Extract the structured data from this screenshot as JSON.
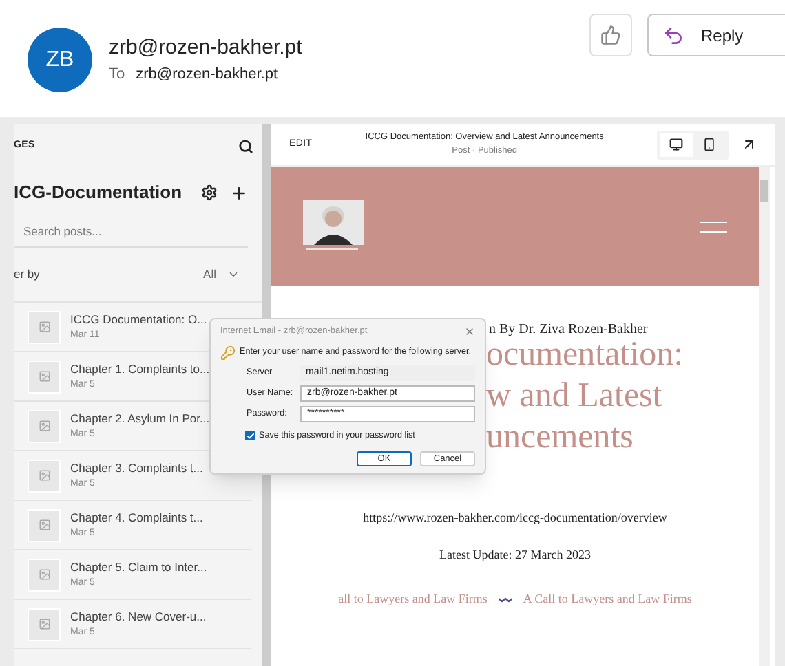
{
  "email": {
    "avatar_initials": "ZB",
    "sender": "zrb@rozen-bakher.pt",
    "to_label": "To",
    "to_address": "zrb@rozen-bakher.pt",
    "reply": "Reply"
  },
  "sidebar": {
    "section_label": "GES",
    "title": "ICG-Documentation",
    "search": {
      "placeholder": "Search posts..."
    },
    "filter_label": "er by",
    "filter_value": "All",
    "posts": [
      {
        "title": "ICCG Documentation: O...",
        "date": "Mar 11"
      },
      {
        "title": "Chapter 1. Complaints to...",
        "date": "Mar 5"
      },
      {
        "title": "Chapter 2. Asylum In Por...",
        "date": "Mar 5"
      },
      {
        "title": "Chapter 3. Complaints t...",
        "date": "Mar 5"
      },
      {
        "title": "Chapter 4. Complaints t...",
        "date": "Mar 5"
      },
      {
        "title": "Chapter 5. Claim to Inter...",
        "date": "Mar 5"
      },
      {
        "title": "Chapter 6. New Cover-u...",
        "date": "Mar 5"
      }
    ]
  },
  "editor": {
    "edit": "EDIT",
    "title": "ICCG Documentation: Overview and Latest Announcements",
    "subtitle": "Post · Published",
    "view_modes": [
      {
        "kind": "desktop",
        "selected": true
      },
      {
        "kind": "mobile",
        "selected": false
      }
    ]
  },
  "preview": {
    "byline": "n By Dr. Ziva Rozen-Bakher",
    "heading_lines": [
      "ocumentation:",
      "w and Latest",
      "uncements"
    ],
    "url": "https://www.rozen-bakher.com/iccg-documentation/overview",
    "update": "Latest Update: 27 March 2023",
    "links": [
      "all to Lawyers and Law Firms",
      "A Call to Lawyers and Law Firms"
    ]
  },
  "dialog": {
    "title": "Internet Email - zrb@rozen-bakher.pt",
    "prompt": "Enter your user name and password for the following server.",
    "fields": [
      {
        "kind": "static",
        "label": "Server",
        "value": "mail1.netim.hosting"
      },
      {
        "kind": "text",
        "label": "User Name:",
        "value": "zrb@rozen-bakher.pt"
      },
      {
        "kind": "password",
        "label": "Password:",
        "value": "**********"
      }
    ],
    "save": {
      "label": "Save this password in your password list",
      "checked": true
    },
    "buttons": [
      "OK",
      "Cancel"
    ]
  }
}
